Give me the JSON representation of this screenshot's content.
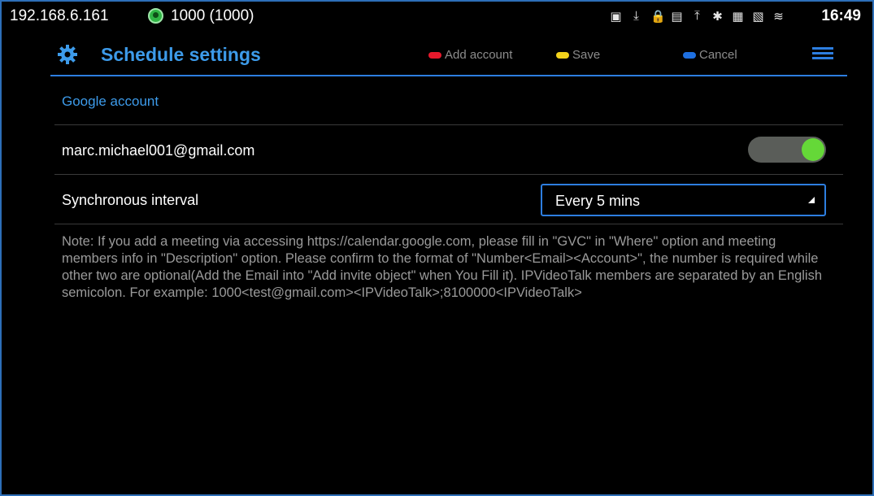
{
  "status_bar": {
    "ip": "192.168.6.161",
    "account": "1000 (1000)",
    "time": "16:49",
    "icons": [
      "screen-icon",
      "download-icon",
      "lock-icon",
      "network-icon",
      "upload-icon",
      "bluetooth-icon",
      "sim-icon",
      "connection-icon",
      "wifi-icon"
    ]
  },
  "header": {
    "title": "Schedule settings",
    "buttons": {
      "add_account": "Add account",
      "save": "Save",
      "cancel": "Cancel"
    },
    "colors": {
      "add_account": "#e8192c",
      "save": "#f2d21b",
      "cancel": "#1e6fe0",
      "accent": "#3d9bea"
    }
  },
  "content": {
    "section_label": "Google account",
    "account_email": "marc.michael001@gmail.com",
    "account_enabled": true,
    "interval_label": "Synchronous interval",
    "interval_value": "Every 5 mins",
    "note": "Note: If you add a meeting via accessing https://calendar.google.com, please fill in \"GVC\" in \"Where\" option and meeting members info in \"Description\" option. Please confirm to the format of \"Number<Email><Account>\", the number is required while other two are optional(Add the Email into \"Add invite object\" when You Fill it). IPVideoTalk members are separated by an English semicolon. For example: 1000<test@gmail.com><IPVideoTalk>;8100000<IPVideoTalk>"
  }
}
